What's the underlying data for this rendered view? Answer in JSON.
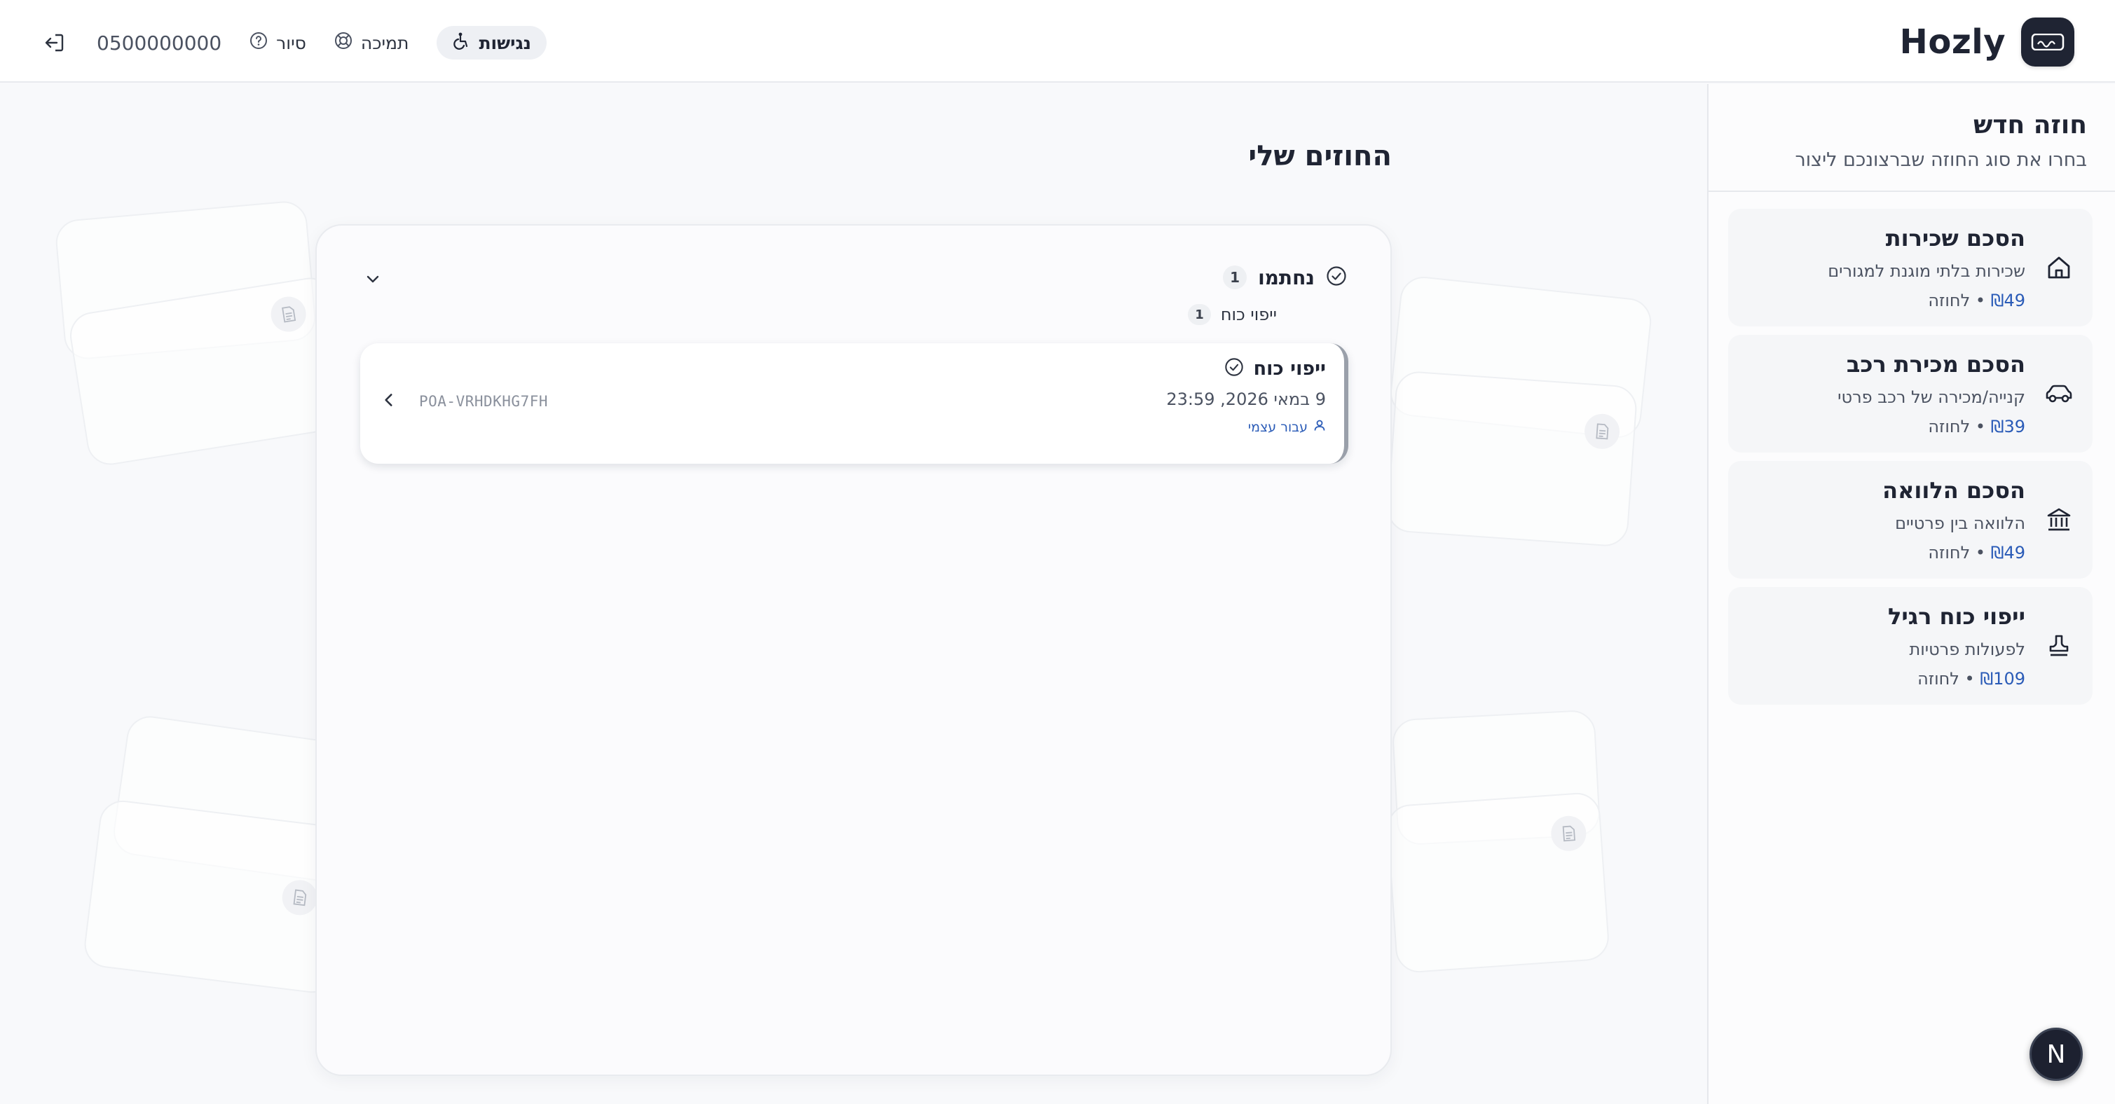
{
  "header": {
    "brand_name": "Hozly",
    "phone": "0500000000",
    "tour_label": "סיור",
    "support_label": "תמיכה",
    "accessibility_label": "נגישות"
  },
  "sidebar": {
    "title": "חוזה חדש",
    "subtitle": "בחרו את סוג החוזה שברצונכם ליצור",
    "templates": [
      {
        "title": "הסכם שכירות",
        "desc": "שכירות בלתי מוגנת למגורים",
        "price": "₪49",
        "per": "• לחוזה",
        "icon": "home-icon"
      },
      {
        "title": "הסכם מכירת רכב",
        "desc": "קנייה/מכירה של רכב פרטי",
        "price": "₪39",
        "per": "• לחוזה",
        "icon": "car-icon"
      },
      {
        "title": "הסכם הלוואה",
        "desc": "הלוואה בין פרטיים",
        "price": "₪49",
        "per": "• לחוזה",
        "icon": "bank-icon"
      },
      {
        "title": "ייפוי כוח רגיל",
        "desc": "לפעולות פרטיות",
        "price": "₪109",
        "per": "• לחוזה",
        "icon": "stamp-icon"
      }
    ]
  },
  "main": {
    "title": "החוזים שלי",
    "section": {
      "title": "נחתמו",
      "count": "1"
    },
    "group": {
      "title": "ייפוי כוח",
      "count": "1"
    },
    "contract": {
      "title": "ייפוי כוח",
      "date": "9 במאי 2026, 23:59",
      "owner": "עבור עצמי",
      "id": "POA-VRHDKHG7FH"
    }
  },
  "fab": {
    "label": "N"
  },
  "colors": {
    "accent": "#2a5bb7",
    "dark": "#1f2433"
  }
}
